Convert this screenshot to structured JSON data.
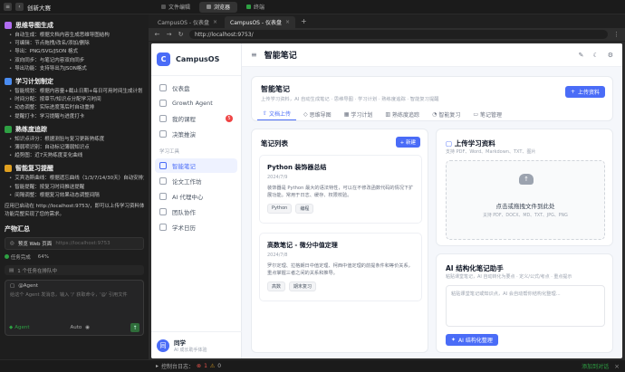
{
  "topbar": {
    "title": "创新大赛",
    "tabs": [
      {
        "label": "文件编辑",
        "color": "#4a4a4a"
      },
      {
        "label": "浏览器",
        "color": "#4a4a4a"
      },
      {
        "label": "终端",
        "color": "#2ea043"
      }
    ]
  },
  "chat": {
    "sections": [
      {
        "title": "思维导图生成",
        "color": "#b06cf0",
        "bullets": [
          "自动生成：根据文档内容生成思维导图结构",
          "可编辑：节点拖拽/改名/添加/删除",
          "导出：PNG/SVG/JSON 格式",
          "双向同步：与笔记内容双向同步",
          "导出功能：支持导出为JSON格式"
        ]
      },
      {
        "title": "学习计划制定",
        "color": "#4a8cf0",
        "bullets": [
          "智能规划：根据内容量+截止日期+每日可用时间生成计划",
          "时间分配：按章节/知识点分配学习时间",
          "动态调整：实际进度落后时自动重排",
          "提醒打卡：学习提醒与进度打卡"
        ]
      },
      {
        "title": "熟练度追踪",
        "color": "#2ea043",
        "bullets": [
          "知识点评分：根据测验与复习更新熟练度",
          "薄弱项识别：自动标记薄弱知识点",
          "趋势图：近7天熟练度变化曲线"
        ]
      },
      {
        "title": "智能复习提醒",
        "color": "#e0a020",
        "bullets": [
          "艾宾浩斯曲线：根据遗忘曲线（1/3/7/14/30天）自动安排复习",
          "智能提醒：按复习时间推送提醒",
          "间隔调整：根据复习效果动态调整间隔"
        ]
      }
    ],
    "footer_text_1": "应用已启动在 http://localhost:9753/，即可以上传学习资料体验",
    "footer_text_2": "功能完整实现了您的需求。",
    "output_title": "产物汇总",
    "preview_label": "预览 Web 页面",
    "preview_url": "https://localhost:9753",
    "status_running": "任务完成",
    "status_percent": "64%",
    "queue_text": "1 个任务在排队中",
    "agent_label": "@Agent",
    "agent_placeholder": "给这个 Agent 发消息，输入 '/' 获取命令，'@' 引用文件",
    "agent_mode": "Agent",
    "agent_model": "Auto"
  },
  "browser": {
    "tabs": [
      {
        "label": "CampusOS - 仪表盘",
        "active": false
      },
      {
        "label": "CampusOS - 仪表盘",
        "active": true
      }
    ],
    "url": "http://localhost:9753/"
  },
  "app": {
    "name": "CampusOS",
    "nav": [
      {
        "label": "仪表盘",
        "icon": "dashboard-icon",
        "active": false
      },
      {
        "label": "Growth Agent",
        "icon": "agent-icon",
        "active": false
      },
      {
        "label": "我的课程",
        "icon": "course-icon",
        "active": false,
        "badge": "5"
      },
      {
        "label": "决策推演",
        "icon": "decision-icon",
        "active": false
      }
    ],
    "group_label": "学习工具",
    "nav2": [
      {
        "label": "智能笔记",
        "icon": "note-icon",
        "active": true
      },
      {
        "label": "论文工作坊",
        "icon": "paper-icon",
        "active": false
      },
      {
        "label": "AI 代理中心",
        "icon": "ai-icon",
        "active": false
      },
      {
        "label": "团队协作",
        "icon": "team-icon",
        "active": false
      },
      {
        "label": "学术日历",
        "icon": "calendar-icon",
        "active": false
      }
    ],
    "user_name": "同学",
    "user_sub": "AI 成长助手体验"
  },
  "page": {
    "title": "智能笔记",
    "header": {
      "title": "智能笔记",
      "subtitle": "上传学习资料，AI 自动生成笔记 · 思维导图 · 学习计划 · 熟练度追踪 · 智能复习提醒",
      "upload_label": "上传资料",
      "tabs": [
        "文档上传",
        "思维导图",
        "学习计划",
        "熟练度追踪",
        "智能复习",
        "笔记管理"
      ]
    },
    "list": {
      "title": "笔记列表",
      "new_label": "+ 新建",
      "notes": [
        {
          "title": "Python 装饰器总结",
          "date": "2024/7/9",
          "excerpt": "装饰器是 Python 最大的语法特性，可以在不修改函数代码的情况下扩展功能。常用于日志、缓存、权限校验。",
          "tags": [
            "Python",
            "编程"
          ]
        },
        {
          "title": "高数笔记 - 微分中值定理",
          "date": "2024/7/8",
          "excerpt": "罗尔定理、拉格朗日中值定理、柯西中值定理的前提条件和等价关系，重点掌握三者之间的关系和推导。",
          "tags": [
            "高数",
            "期末复习"
          ]
        }
      ]
    },
    "upload": {
      "title": "上传学习资料",
      "subtitle": "支持 PDF、Word、Markdown、TXT、图片",
      "drop_title": "点击或拖拽文件到此处",
      "drop_sub": "支持 PDF、DOCX、MD、TXT、JPG、PNG"
    },
    "ai": {
      "title": "AI 结构化笔记助手",
      "subtitle": "粘贴课堂笔记，AI 自动转化为要点 · 定义/公式/考点 · 重点提示",
      "placeholder": "粘贴课堂笔记或知识点，AI 会自动帮你结构化整理...",
      "button_label": "AI 结构化整理"
    }
  },
  "statusbar": {
    "left": "控制台日志：",
    "errors": "1",
    "warnings": "0",
    "right": "添加到对话"
  }
}
